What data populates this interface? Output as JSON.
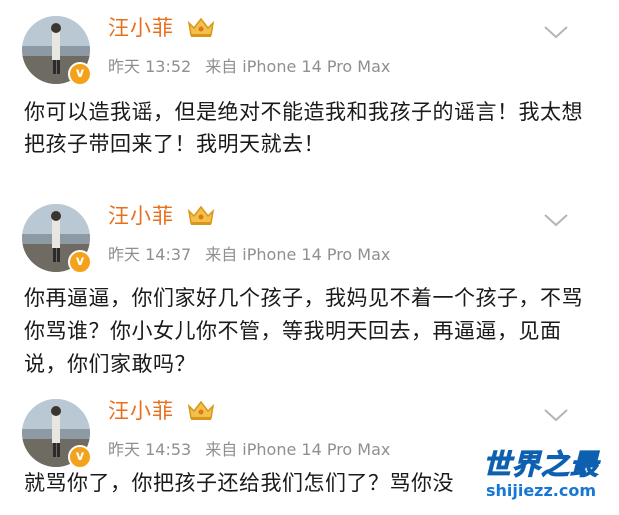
{
  "posts": [
    {
      "user_name": "汪小菲",
      "time": "昨天 13:52",
      "source": "来自 iPhone 14 Pro Max",
      "text": "你可以造我谣，但是绝对不能造我和我孩子的谣言！我太想把孩子带回来了！我明天就去！"
    },
    {
      "user_name": "汪小菲",
      "time": "昨天 14:37",
      "source": "来自 iPhone 14 Pro Max",
      "text": "你再逼逼，你们家好几个孩子，我妈见不着一个孩子，不骂你骂谁？你小女儿你不管，等我明天回去，再逼逼，见面说，你们家敢吗？"
    },
    {
      "user_name": "汪小菲",
      "time": "昨天 14:53",
      "source": "来自 iPhone 14 Pro Max",
      "text": "就骂你了，你把孩子还给我们怎们了？骂你没"
    }
  ],
  "watermark": {
    "title": "世界之最",
    "domain": "shijiezz.com"
  },
  "colors": {
    "username": "#ea6f1b",
    "meta": "#8f8f8f",
    "badge": "#f4a21c",
    "watermark": "#1677d6"
  },
  "icons": {
    "verified_badge": "verified-badge-icon",
    "crown": "crown-icon",
    "more": "chevron-down-icon"
  }
}
